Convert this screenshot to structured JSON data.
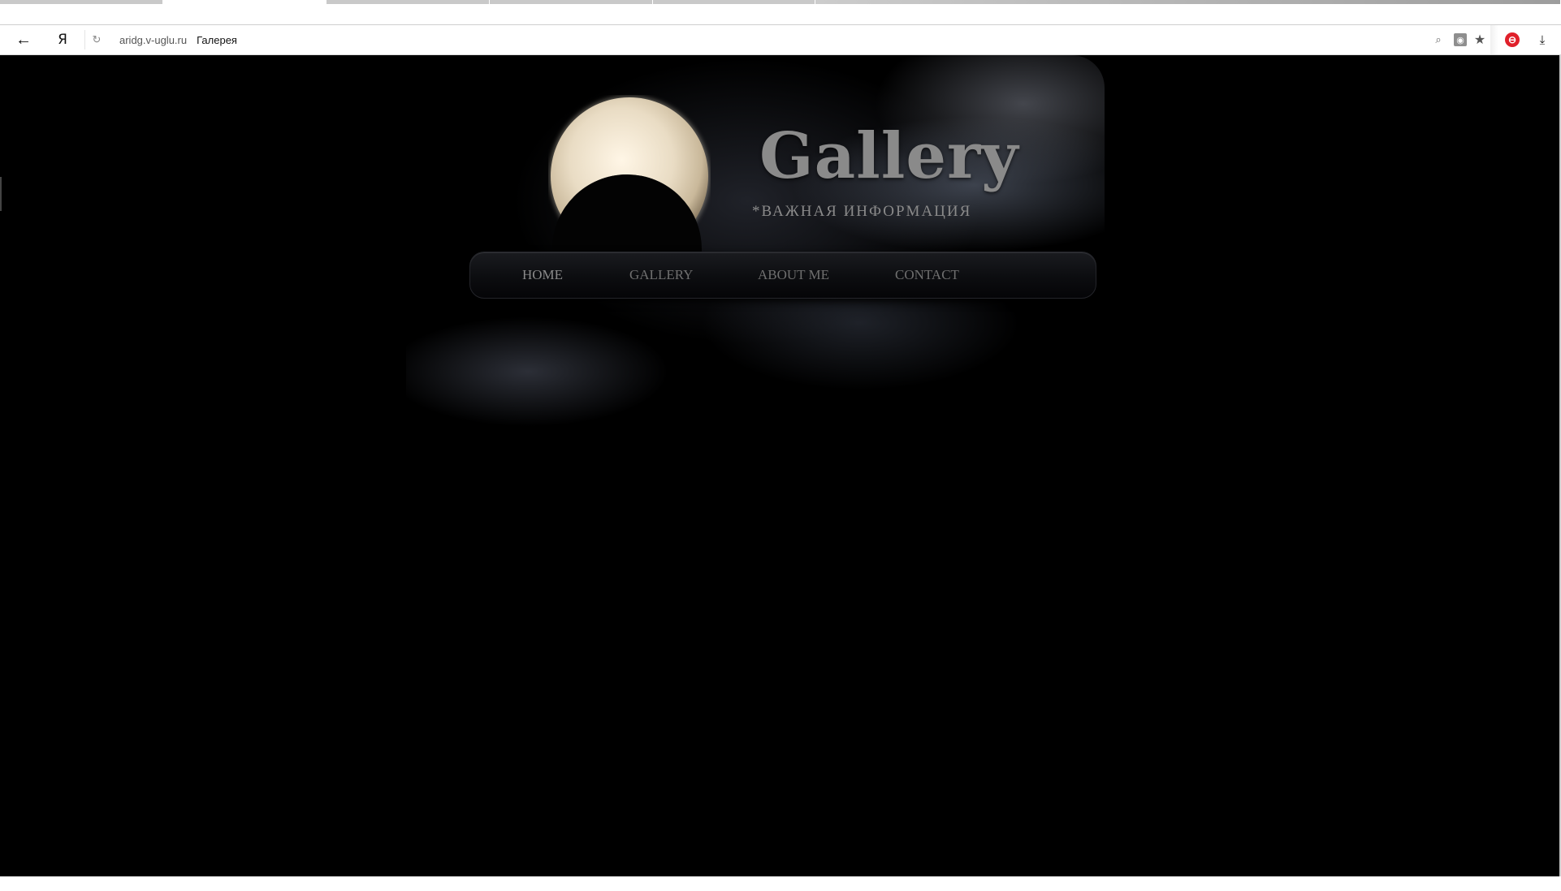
{
  "browser": {
    "yandex_label": "Я",
    "address": {
      "domain": "aridg.v-uglu.ru",
      "page_title": "Галерея"
    },
    "icons": {
      "back": "back-arrow-icon",
      "yandex": "yandex-logo-icon",
      "reload": "reload-icon",
      "zoom": "zoom-icon",
      "translate": "translate-icon",
      "bookmark": "star-icon",
      "adblock": "adblock-icon",
      "download": "download-icon"
    },
    "accent_colors": {
      "adblock": "#e0202a"
    }
  },
  "site": {
    "title": "Gallery",
    "subtitle": "*ВАЖНАЯ ИНФОРМАЦИЯ",
    "nav": [
      {
        "label": "HOME"
      },
      {
        "label": "GALLERY"
      },
      {
        "label": "ABOUT ME"
      },
      {
        "label": "CONTACT"
      }
    ],
    "colors": {
      "background": "#000000",
      "title": "#8a8a8a",
      "nav_text": "#6f6f6f"
    }
  }
}
